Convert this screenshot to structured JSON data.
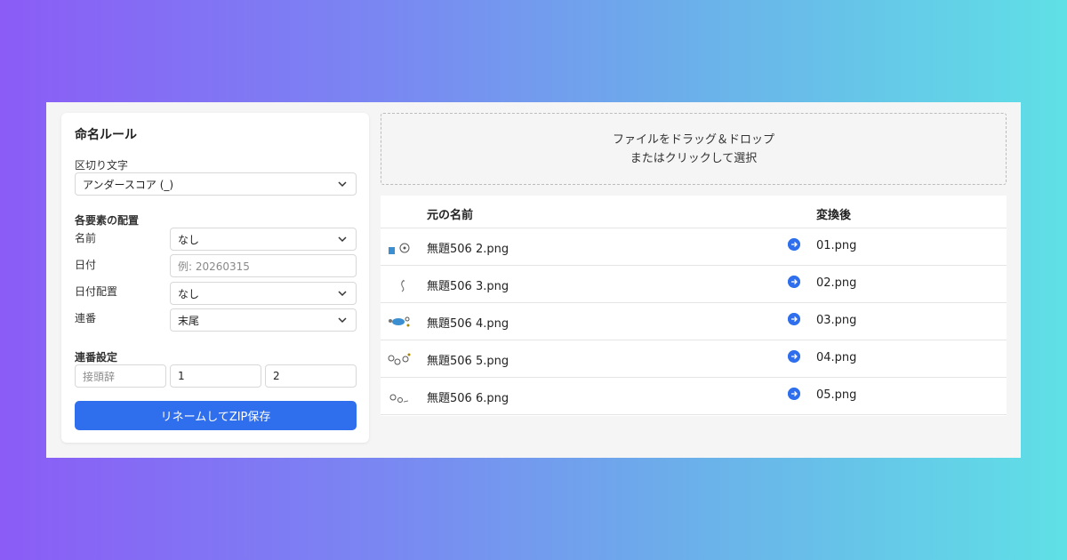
{
  "rules": {
    "title": "命名ルール",
    "separator": {
      "label": "区切り文字",
      "value": "アンダースコア (_)"
    },
    "placement": {
      "title": "各要素の配置",
      "name": {
        "label": "名前",
        "value": "なし"
      },
      "date": {
        "label": "日付",
        "placeholder": "例: 20260315"
      },
      "date_placement": {
        "label": "日付配置",
        "value": "なし"
      },
      "serial": {
        "label": "連番",
        "value": "末尾"
      }
    },
    "serial_settings": {
      "title": "連番設定",
      "prefix_placeholder": "接頭辞",
      "start": "1",
      "digits": "2"
    },
    "submit_label": "リネームしてZIP保存"
  },
  "dropzone": {
    "line1": "ファイルをドラッグ＆ドロップ",
    "line2": "またはクリックして選択"
  },
  "table": {
    "col_original": "元の名前",
    "col_renamed": "変換後",
    "rows": [
      {
        "original": "無題506 2.png",
        "renamed": "01.png"
      },
      {
        "original": "無題506 3.png",
        "renamed": "02.png"
      },
      {
        "original": "無題506 4.png",
        "renamed": "03.png"
      },
      {
        "original": "無題506 5.png",
        "renamed": "04.png"
      },
      {
        "original": "無題506 6.png",
        "renamed": "05.png"
      }
    ]
  },
  "colors": {
    "accent": "#2f6fed",
    "background_left": "#8b5cf6",
    "background_right": "#5fe0e6"
  },
  "icons": {
    "select": "chevron-down-icon",
    "row_arrow": "arrow-right-circle-icon",
    "thumbnail": "image-thumbnail-icon"
  }
}
